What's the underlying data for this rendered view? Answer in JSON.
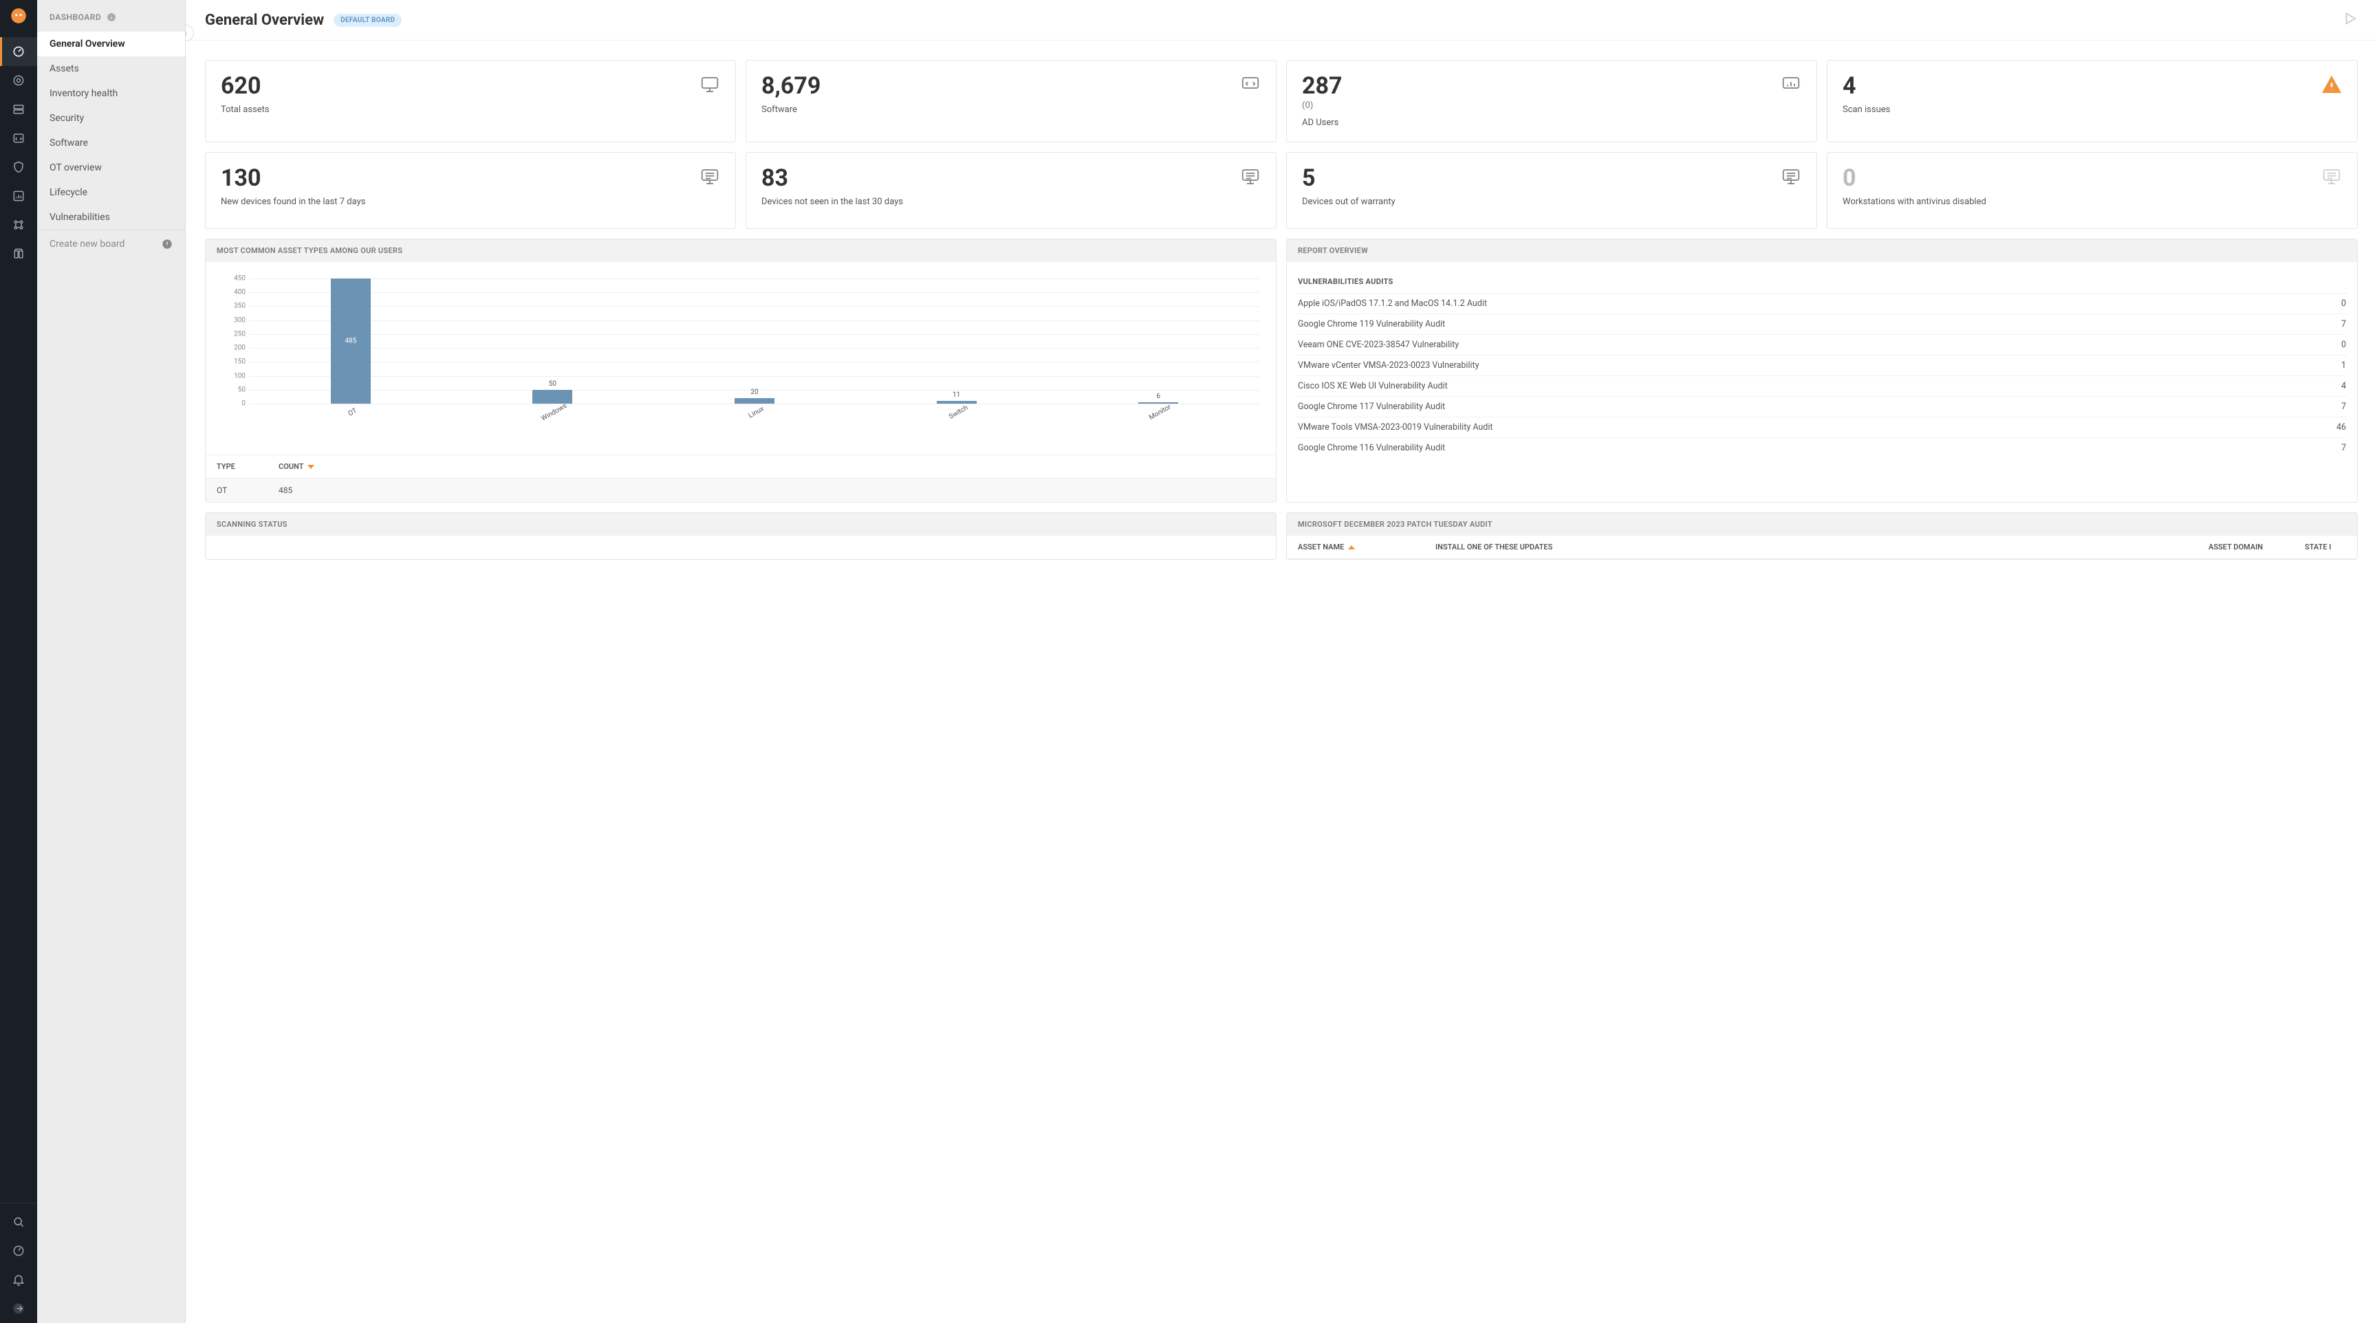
{
  "iconbar": {
    "items": [
      "dashboard",
      "scan",
      "server",
      "code",
      "shield",
      "analytics",
      "integrations",
      "storage"
    ],
    "bottom": [
      "search",
      "dashboard-alt",
      "notifications",
      "logout"
    ]
  },
  "sidebar": {
    "header": "DASHBOARD",
    "items": [
      {
        "label": "General Overview",
        "active": true
      },
      {
        "label": "Assets"
      },
      {
        "label": "Inventory health"
      },
      {
        "label": "Security"
      },
      {
        "label": "Software"
      },
      {
        "label": "OT overview"
      },
      {
        "label": "Lifecycle"
      },
      {
        "label": "Vulnerabilities"
      }
    ],
    "create": "Create new board"
  },
  "topbar": {
    "title": "General Overview",
    "badge": "DEFAULT BOARD"
  },
  "cards_row1": [
    {
      "value": "620",
      "label": "Total assets",
      "icon": "monitor"
    },
    {
      "value": "8,679",
      "label": "Software",
      "icon": "code-monitor"
    },
    {
      "value": "287",
      "sub": "(0)",
      "label": "AD Users",
      "icon": "chart-monitor"
    },
    {
      "value": "4",
      "label": "Scan issues",
      "icon": "warning",
      "warn": true
    }
  ],
  "cards_row2": [
    {
      "value": "130",
      "label": "New devices found in the last 7 days",
      "icon": "list-monitor"
    },
    {
      "value": "83",
      "label": "Devices not seen in the last 30 days",
      "icon": "list-monitor"
    },
    {
      "value": "5",
      "label": "Devices out of warranty",
      "icon": "list-monitor"
    },
    {
      "value": "0",
      "label": "Workstations with antivirus disabled",
      "icon": "list-monitor",
      "muted": true
    }
  ],
  "panel_assets": {
    "title": "MOST COMMON ASSET TYPES AMONG OUR USERS",
    "table_head": {
      "type": "TYPE",
      "count": "COUNT"
    },
    "first_row": {
      "type": "OT",
      "count": "485"
    }
  },
  "panel_report": {
    "title": "REPORT OVERVIEW",
    "section": "VULNERABILITIES AUDITS",
    "rows": [
      {
        "name": "Apple iOS/iPadOS 17.1.2 and MacOS 14.1.2 Audit",
        "count": "0"
      },
      {
        "name": "Google Chrome 119 Vulnerability Audit",
        "count": "7"
      },
      {
        "name": "Veeam ONE CVE-2023-38547 Vulnerability",
        "count": "0"
      },
      {
        "name": "VMware vCenter VMSA-2023-0023 Vulnerability",
        "count": "1"
      },
      {
        "name": "Cisco IOS XE Web UI Vulnerability Audit",
        "count": "4"
      },
      {
        "name": "Google Chrome 117 Vulnerability Audit",
        "count": "7"
      },
      {
        "name": "VMware Tools VMSA-2023-0019 Vulnerability Audit",
        "count": "46"
      },
      {
        "name": "Google Chrome 116 Vulnerability Audit",
        "count": "7"
      }
    ]
  },
  "panel_scanning": {
    "title": "SCANNING STATUS"
  },
  "panel_patch": {
    "title": "MICROSOFT DECEMBER 2023 PATCH TUESDAY AUDIT",
    "headers": {
      "name": "ASSET NAME",
      "install": "INSTALL ONE OF THESE UPDATES",
      "domain": "ASSET DOMAIN",
      "state": "STATE I"
    }
  },
  "chart_data": {
    "type": "bar",
    "categories": [
      "OT",
      "Windows",
      "Linux",
      "Switch",
      "Monitor"
    ],
    "values": [
      485,
      50,
      20,
      11,
      6
    ],
    "title": "",
    "xlabel": "",
    "ylabel": "",
    "ylim": [
      0,
      450
    ],
    "yticks": [
      0,
      50,
      100,
      150,
      200,
      250,
      300,
      350,
      400,
      450
    ]
  }
}
